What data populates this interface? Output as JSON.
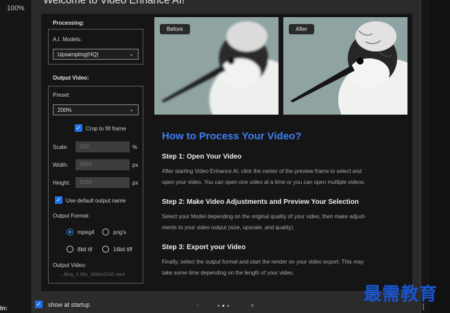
{
  "app": {
    "zoom": "100%",
    "side_label": "In:",
    "right_mark": "["
  },
  "dialog": {
    "title": "Welcome to Video Enhance AI!",
    "processing": {
      "title": "Processing:",
      "models_label": "A.I. Models:",
      "model_value": "Upsampling(HQ)"
    },
    "output_video": {
      "title": "Output Video:",
      "preset_label": "Preset:",
      "preset_value": "200%",
      "crop_label": "Crop to fill frame",
      "crop_checked": true,
      "scale_label": "Scale:",
      "scale_value": "200",
      "scale_unit": "%",
      "width_label": "Width:",
      "width_value": "3840",
      "width_unit": "px",
      "height_label": "Height:",
      "height_value": "2160",
      "height_unit": "px",
      "default_name_label": "Use default output name",
      "default_name_checked": true,
      "format_label": "Output Format:",
      "formats": [
        {
          "label": "mpeg4",
          "selected": true
        },
        {
          "label": "png's",
          "selected": false
        },
        {
          "label": "8bit tif",
          "selected": false
        },
        {
          "label": "16bit tiff",
          "selected": false
        }
      ],
      "output_label": "Output Video:",
      "output_file": "...illing_2.00x_3840x2160.mp4"
    },
    "preview": {
      "before_label": "Before",
      "after_label": "After"
    },
    "heading": "How to Process Your Video?",
    "steps": [
      {
        "title": "Step 1: Open Your Video",
        "lines": [
          "After starting Video Enhance AI, click the center of the preview frame to select and",
          "open your video. You can open one video at a time or you can open multiple videos."
        ]
      },
      {
        "title": "Step 2: Make Video Adjustments and Preview Your Selection",
        "lines": [
          "Select your Model depending on the original quality of your video, then make adjust-",
          "ments to your video output (size, upscale, and quality)."
        ]
      },
      {
        "title": "Step 3: Export your Video",
        "lines": [
          "Finally, select the output format and start the render on your video export. This may",
          "take some time depending on the length of your video."
        ]
      }
    ],
    "footer": {
      "show_startup_label": "show at startup",
      "show_startup_checked": true,
      "prev": "<",
      "next": ">",
      "page_count": 3,
      "active_page": 2
    }
  },
  "watermark": "最需教育",
  "colors": {
    "accent": "#1e72e8",
    "heading": "#3f7ff5",
    "watermark": "#1a55cf"
  },
  "icons": {
    "check": "checkmark-icon",
    "chevron": "chevron-down-icon"
  }
}
